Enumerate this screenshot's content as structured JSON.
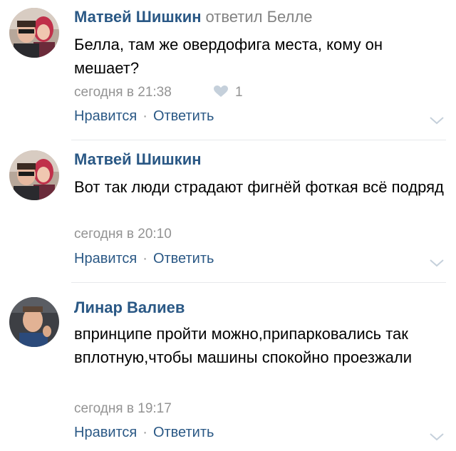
{
  "colors": {
    "link": "#2a5885",
    "muted": "#939393",
    "text": "#000000",
    "divider": "#e7e8ec"
  },
  "comments": [
    {
      "author": "Матвей Шишкин",
      "reply_to": "ответил Белле",
      "text": "Белла, там же овердофига места, кому он мешает?",
      "time": "сегодня в 21:38",
      "likes": "1",
      "like_label": "Нравится",
      "separator": "·",
      "reply_label": "Ответить",
      "avatar_icon": "couple-photo"
    },
    {
      "author": "Матвей Шишкин",
      "text": "Вот так люди страдают фигнёй фоткая всё подряд",
      "time": "сегодня в 20:10",
      "like_label": "Нравится",
      "separator": "·",
      "reply_label": "Ответить",
      "avatar_icon": "couple-photo"
    },
    {
      "author": "Линар Валиев",
      "text": "впринципе пройти можно,припарковались так вплотную,чтобы машины спокойно проезжали",
      "time": "сегодня в 19:17",
      "like_label": "Нравится",
      "separator": "·",
      "reply_label": "Ответить",
      "avatar_icon": "man-photo"
    }
  ]
}
